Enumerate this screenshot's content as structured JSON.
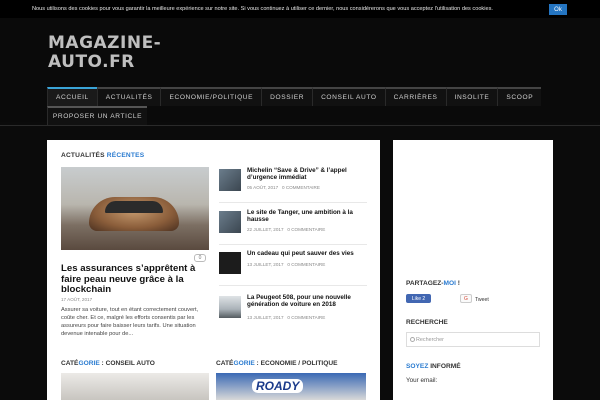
{
  "cookie": {
    "text": "Nous utilisons des cookies pour vous garantir la meilleure expérience sur notre site. Si vous continuez à utiliser ce dernier, nous considérerons que vous acceptez l'utilisation des cookies.",
    "ok_label": "Ok"
  },
  "site": {
    "logo_line1": "MAGAZINE-",
    "logo_line2": "AUTO.FR"
  },
  "nav": {
    "items": [
      "ACCUEIL",
      "ACTUALITÉS",
      "ECONOMIE/POLITIQUE",
      "DOSSIER",
      "CONSEIL AUTO",
      "CARRIÈRES",
      "INSOLITE",
      "SCOOP"
    ],
    "row2": [
      "PROPOSER UN ARTICLE"
    ]
  },
  "recent": {
    "heading_part1": "ACTUALITÉS",
    "heading_part2": " RÉCENTES",
    "featured": {
      "comments": "0",
      "title": "Les assurances s’apprêtent à faire peau neuve grâce à la blockchain",
      "date": "17 AOÛT, 2017",
      "excerpt": "Assurer sa voiture, tout en étant correctement couvert, coûte cher. Et ce, malgré les efforts consentis par les assureurs pour faire baisser leurs tarifs. Une situation devenue intenable pour de..."
    },
    "list": [
      {
        "title": "Michelin “Save & Drive” & l’appel d’urgence immédiat",
        "date": "05 AOÛT, 2017",
        "comments": "0 COMMENTAIRE"
      },
      {
        "title": "Le site de Tanger, une ambition à la hausse",
        "date": "22 JUILLET, 2017",
        "comments": "0 COMMENTAIRE"
      },
      {
        "title": "Un cadeau qui peut sauver des vies",
        "date": "13 JUILLET, 2017",
        "comments": "0 COMMENTAIRE"
      },
      {
        "title": "La Peugeot 508, pour une nouvelle génération de voiture en 2018",
        "date": "13 JUILLET, 2017",
        "comments": "0 COMMENTAIRE"
      }
    ]
  },
  "categories": [
    {
      "prefix": "CATÉ",
      "accent": "GORIE",
      "name": " : CONSEIL AUTO"
    },
    {
      "prefix": "CATÉ",
      "accent": "GORIE",
      "name": " : ECONOMIE / POLITIQUE"
    }
  ],
  "roady_logo": "ROADY",
  "sidebar": {
    "share_title_part1": "PARTAGEZ-",
    "share_title_part2": "MOI",
    "share_title_part3": " !",
    "fb_like": "Like 2",
    "gplus": "G",
    "tweet": "Tweet",
    "search_title": "RECHERCHE",
    "search_placeholder": "Rechercher",
    "inform_title_part1": "SOYEZ",
    "inform_title_part2": " INFORMÉ",
    "email_label": "Your email:"
  },
  "colors": {
    "accent": "#2a7bd0",
    "nav_active": "#3aa4d8",
    "cookie_button": "#2475c2"
  }
}
